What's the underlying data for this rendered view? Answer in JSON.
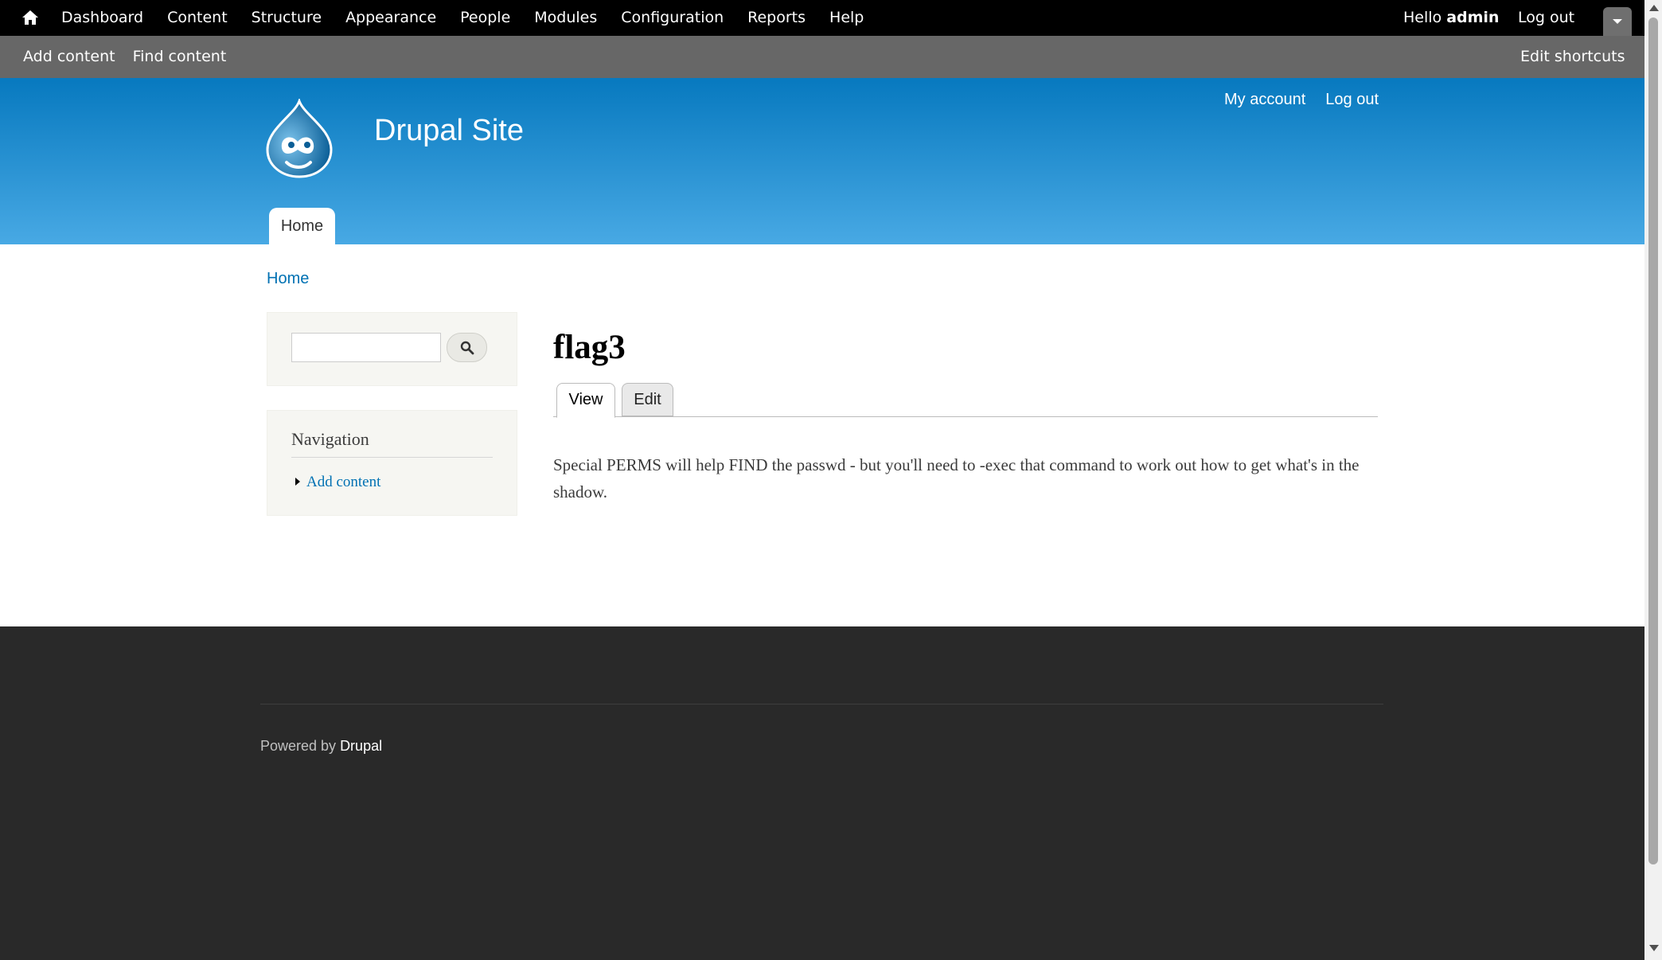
{
  "toolbar": {
    "menu": [
      "Dashboard",
      "Content",
      "Structure",
      "Appearance",
      "People",
      "Modules",
      "Configuration",
      "Reports",
      "Help"
    ],
    "hello_prefix": "Hello ",
    "username": "admin",
    "logout": "Log out"
  },
  "shortcuts": {
    "items": [
      "Add content",
      "Find content"
    ],
    "edit": "Edit shortcuts"
  },
  "header": {
    "site_name": "Drupal Site",
    "secondary_links": [
      "My account",
      "Log out"
    ],
    "main_tab": "Home"
  },
  "breadcrumb": "Home",
  "sidebar": {
    "search": {
      "value": "",
      "placeholder": ""
    },
    "navigation": {
      "title": "Navigation",
      "items": [
        "Add content"
      ]
    }
  },
  "node": {
    "title": "flag3",
    "tabs": [
      "View",
      "Edit"
    ],
    "body": "Special PERMS will help FIND the passwd - but you'll need to -exec that command to work out how to get what's in the shadow."
  },
  "footer": {
    "powered_prefix": "Powered by ",
    "powered_link": "Drupal"
  },
  "colors": {
    "toolbar": "#000000",
    "shortcuts_bar": "#676767",
    "header_top": "#0779bf",
    "header_bottom": "#48a9e4",
    "link": "#0071b3",
    "footer": "#292929"
  }
}
